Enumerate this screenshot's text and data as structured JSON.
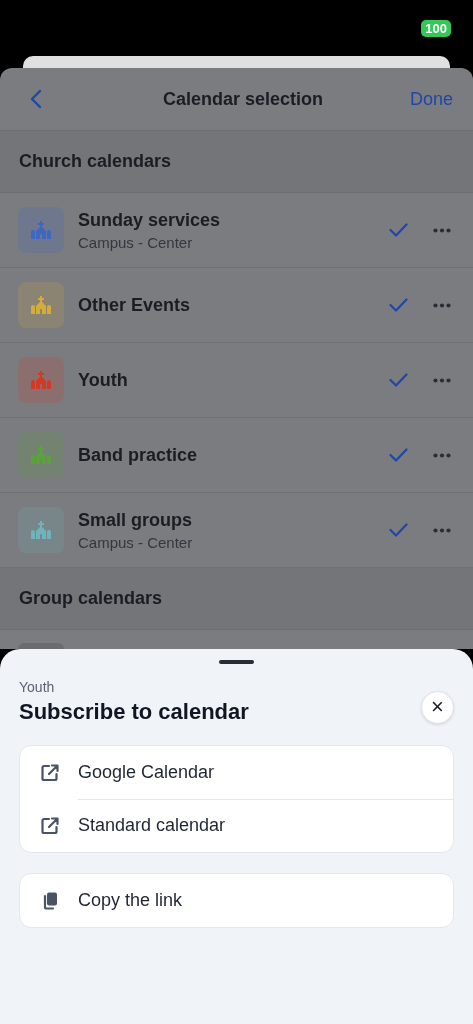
{
  "status_bar": {
    "battery": "100"
  },
  "nav": {
    "title": "Calendar selection",
    "done": "Done"
  },
  "sections": [
    {
      "title": "Church calendars",
      "calendars": [
        {
          "name": "Sunday services",
          "subtitle": "Campus - Center",
          "color": "#3d67c2",
          "checked": true
        },
        {
          "name": "Other Events",
          "color": "#d4ac3a",
          "checked": true
        },
        {
          "name": "Youth",
          "color": "#d23a26",
          "checked": true
        },
        {
          "name": "Band practice",
          "color": "#5aa23a",
          "checked": true
        },
        {
          "name": "Small groups",
          "subtitle": "Campus - Center",
          "color": "#6fb4bc",
          "checked": true
        }
      ]
    },
    {
      "title": "Group calendars"
    }
  ],
  "sheet": {
    "caption": "Youth",
    "title": "Subscribe to calendar",
    "close": "×",
    "groups": [
      [
        {
          "kind": "external",
          "label": "Google Calendar"
        },
        {
          "kind": "external",
          "label": "Standard calendar"
        }
      ],
      [
        {
          "kind": "copy",
          "label": "Copy the link"
        }
      ]
    ]
  }
}
